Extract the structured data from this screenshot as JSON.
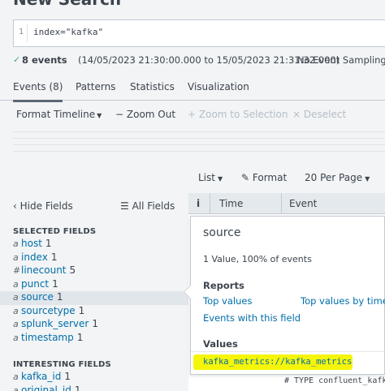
{
  "header": {
    "title": "New Search"
  },
  "search": {
    "line_number": "1",
    "query": "index=\"kafka\""
  },
  "status": {
    "check_glyph": "✓",
    "events_count": "8 events",
    "range": "(14/05/2023 21:30:00.000 to 15/05/2023 21:31:32.000)",
    "sampling": "No Event Sampling"
  },
  "tabs": [
    {
      "label": "Events (8)"
    },
    {
      "label": "Patterns"
    },
    {
      "label": "Statistics"
    },
    {
      "label": "Visualization"
    }
  ],
  "timeline": {
    "format": "Format Timeline",
    "zoom_out": "Zoom Out",
    "zoom_to_selection": "Zoom to Selection",
    "deselect": "Deselect"
  },
  "results_toolbar": {
    "list": "List",
    "format": "Format",
    "per_page": "20 Per Page"
  },
  "fields_panel": {
    "hide_fields": "Hide Fields",
    "all_fields": "All Fields",
    "selected_title": "SELECTED FIELDS",
    "selected": [
      {
        "type": "a",
        "name": "host",
        "count": "1"
      },
      {
        "type": "a",
        "name": "index",
        "count": "1"
      },
      {
        "type": "#",
        "name": "linecount",
        "count": "5"
      },
      {
        "type": "a",
        "name": "punct",
        "count": "1"
      },
      {
        "type": "a",
        "name": "source",
        "count": "1"
      },
      {
        "type": "a",
        "name": "sourcetype",
        "count": "1"
      },
      {
        "type": "a",
        "name": "splunk_server",
        "count": "1"
      },
      {
        "type": "a",
        "name": "timestamp",
        "count": "1"
      }
    ],
    "interesting_title": "INTERESTING FIELDS",
    "interesting": [
      {
        "type": "a",
        "name": "kafka_id",
        "count": "1"
      },
      {
        "type": "a",
        "name": "original_id",
        "count": "1"
      }
    ]
  },
  "table_header": {
    "info": "i",
    "time": "Time",
    "event": "Event"
  },
  "event_snippet": "# TYPE confluent_kafka",
  "popover": {
    "title": "source",
    "summary": "1 Value, 100% of events",
    "reports_title": "Reports",
    "top_values": "Top values",
    "top_values_by_time": "Top values by time",
    "events_with_field": "Events with this field",
    "values_title": "Values",
    "value": "kafka_metrics://kafka_metrics"
  },
  "colors": {
    "accent": "#006eaa",
    "highlight": "#f5f50a",
    "success": "#4fa484"
  }
}
